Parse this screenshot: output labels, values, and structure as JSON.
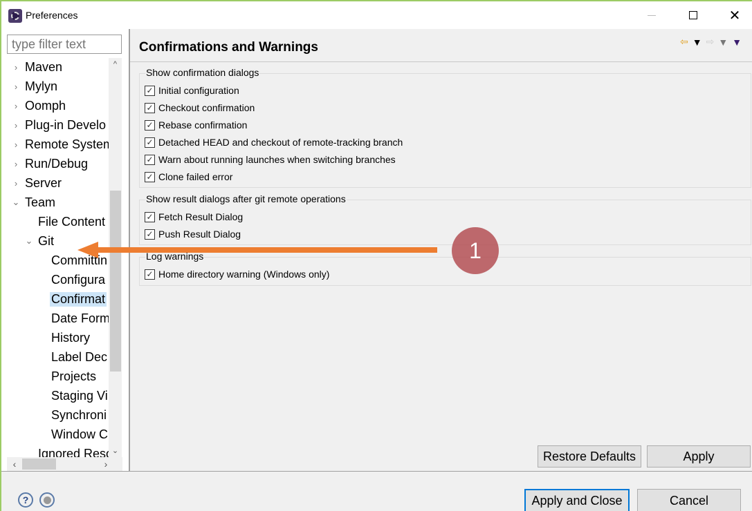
{
  "window": {
    "title": "Preferences",
    "controls": {
      "minimize": "minimize",
      "maximize": "maximize",
      "close": "✕"
    }
  },
  "sidebar": {
    "filter_placeholder": "type filter text",
    "items": [
      {
        "label": "Maven",
        "level": 0,
        "expander": "›"
      },
      {
        "label": "Mylyn",
        "level": 0,
        "expander": "›"
      },
      {
        "label": "Oomph",
        "level": 0,
        "expander": "›"
      },
      {
        "label": "Plug-in Develo",
        "level": 0,
        "expander": "›"
      },
      {
        "label": "Remote System",
        "level": 0,
        "expander": "›"
      },
      {
        "label": "Run/Debug",
        "level": 0,
        "expander": "›"
      },
      {
        "label": "Server",
        "level": 0,
        "expander": "›"
      },
      {
        "label": "Team",
        "level": 0,
        "expander": "⌄"
      },
      {
        "label": "File Content",
        "level": 1,
        "expander": ""
      },
      {
        "label": "Git",
        "level": 1,
        "expander": "⌄"
      },
      {
        "label": "Committin",
        "level": 2,
        "expander": ""
      },
      {
        "label": "Configura",
        "level": 2,
        "expander": ""
      },
      {
        "label": "Confirmat",
        "level": 2,
        "expander": "",
        "selected": true
      },
      {
        "label": "Date Form",
        "level": 2,
        "expander": ""
      },
      {
        "label": "History",
        "level": 2,
        "expander": ""
      },
      {
        "label": "Label Dec",
        "level": 2,
        "expander": ""
      },
      {
        "label": "Projects",
        "level": 2,
        "expander": ""
      },
      {
        "label": "Staging Vi",
        "level": 2,
        "expander": ""
      },
      {
        "label": "Synchroni",
        "level": 2,
        "expander": ""
      },
      {
        "label": "Window C",
        "level": 2,
        "expander": ""
      },
      {
        "label": "Ignored Reso",
        "level": 1,
        "expander": ""
      }
    ],
    "scroll_up": "^",
    "scroll_down": "⌄",
    "scroll_left": "‹",
    "scroll_right": "›"
  },
  "page": {
    "title": "Confirmations and Warnings",
    "nav": {
      "back": "⇦",
      "forward": "⇨",
      "dropdown": "▼"
    },
    "groups": [
      {
        "label": "Show confirmation dialogs",
        "options": [
          {
            "label": "Initial configuration",
            "checked": true
          },
          {
            "label": "Checkout confirmation",
            "checked": true
          },
          {
            "label": "Rebase confirmation",
            "checked": true
          },
          {
            "label": "Detached HEAD and checkout of remote-tracking branch",
            "checked": true
          },
          {
            "label": "Warn about running launches when switching branches",
            "checked": true
          },
          {
            "label": "Clone failed error",
            "checked": true
          }
        ]
      },
      {
        "label": "Show result dialogs after git remote operations",
        "options": [
          {
            "label": "Fetch Result Dialog",
            "checked": true
          },
          {
            "label": "Push Result Dialog",
            "checked": true
          }
        ]
      },
      {
        "label": "Log warnings",
        "options": [
          {
            "label": "Home directory warning (Windows only)",
            "checked": true
          }
        ]
      }
    ],
    "check_glyph": "✓",
    "restore_defaults": "Restore Defaults",
    "apply": "Apply"
  },
  "footer": {
    "help_icon": "?",
    "apply_and_close": "Apply and Close",
    "cancel": "Cancel"
  },
  "annotation": {
    "badge": "1",
    "arrow_color": "#ed7d31",
    "badge_color": "#b4505a"
  }
}
